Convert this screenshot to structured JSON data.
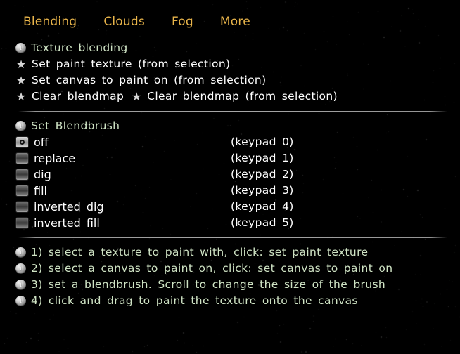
{
  "colors": {
    "background": "#000000",
    "tab_text": "#e8b44a",
    "heading_text": "#cfe3c4",
    "item_text": "#ffffff",
    "separator": "#b4b4b4"
  },
  "tabs": [
    {
      "label": "Blending",
      "icon": "none",
      "active": true
    },
    {
      "label": "Clouds",
      "icon": "none",
      "active": false
    },
    {
      "label": "Fog",
      "icon": "none",
      "active": false
    },
    {
      "label": "More",
      "icon": "none",
      "active": false
    }
  ],
  "blending_section": {
    "heading": {
      "icon": "info-sphere-icon",
      "label": "Texture blending"
    },
    "actions": [
      {
        "icon": "star-icon",
        "label": "Set paint texture (from selection)"
      },
      {
        "icon": "star-icon",
        "label": "Set canvas to paint on (from selection)"
      }
    ],
    "clear_row": {
      "first": {
        "icon": "star-icon",
        "label": "Clear blendmap"
      },
      "second": {
        "icon": "star-icon",
        "label": "Clear blendmap (from selection)"
      }
    }
  },
  "blendbrush_section": {
    "heading": {
      "icon": "info-sphere-icon",
      "label": "Set Blendbrush"
    },
    "options": [
      {
        "label": "off",
        "keyhint": "(keypad 0)",
        "selected": true
      },
      {
        "label": "replace",
        "keyhint": "(keypad 1)",
        "selected": false
      },
      {
        "label": "dig",
        "keyhint": "(keypad 2)",
        "selected": false
      },
      {
        "label": "fill",
        "keyhint": "(keypad 3)",
        "selected": false
      },
      {
        "label": "inverted dig",
        "keyhint": "(keypad 4)",
        "selected": false
      },
      {
        "label": "inverted fill",
        "keyhint": "(keypad 5)",
        "selected": false
      }
    ]
  },
  "instructions": {
    "icon": "info-sphere-icon",
    "lines": [
      "1) select a texture to paint with, click: set paint texture",
      "2) select a canvas to paint on, click: set canvas to paint on",
      "3) set a blendbrush. Scroll to change the size of the brush",
      "4) click and drag to paint the texture onto the canvas"
    ]
  }
}
